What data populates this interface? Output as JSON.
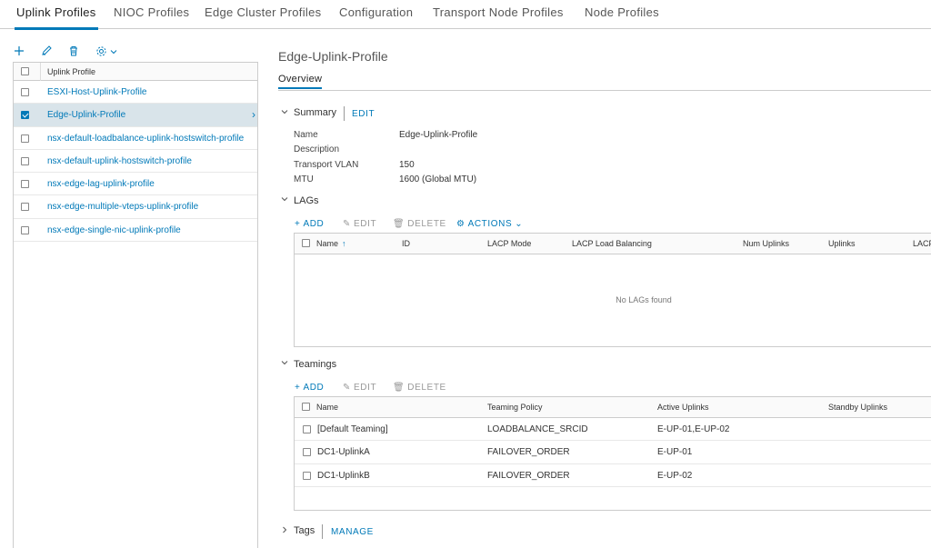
{
  "top_tabs": [
    {
      "label": "Uplink Profiles",
      "active": true
    },
    {
      "label": "NIOC Profiles"
    },
    {
      "label": "Edge Cluster Profiles"
    },
    {
      "label": "Configuration"
    },
    {
      "label": "Transport Node Profiles"
    },
    {
      "label": "Node Profiles"
    }
  ],
  "left_toolbar": {
    "icons": [
      "add-icon",
      "edit-icon",
      "delete-icon",
      "gear-icon",
      "chevron-down-icon"
    ]
  },
  "left_grid": {
    "header": "Uplink Profile",
    "rows": [
      {
        "label": "ESXI-Host-Uplink-Profile",
        "checked": false
      },
      {
        "label": "Edge-Uplink-Profile",
        "checked": true,
        "selected": true
      },
      {
        "label": "nsx-default-loadbalance-uplink-hostswitch-profile",
        "checked": false
      },
      {
        "label": "nsx-default-uplink-hostswitch-profile",
        "checked": false
      },
      {
        "label": "nsx-edge-lag-uplink-profile",
        "checked": false
      },
      {
        "label": "nsx-edge-multiple-vteps-uplink-profile",
        "checked": false
      },
      {
        "label": "nsx-edge-single-nic-uplink-profile",
        "checked": false
      }
    ]
  },
  "detail": {
    "title": "Edge-Uplink-Profile",
    "subtab": "Overview",
    "summary": {
      "label": "Summary",
      "edit": "EDIT",
      "fields": [
        {
          "key": "Name",
          "value": "Edge-Uplink-Profile"
        },
        {
          "key": "Description",
          "value": ""
        },
        {
          "key": "Transport VLAN",
          "value": "150"
        },
        {
          "key": "MTU",
          "value": "1600 (Global MTU)"
        }
      ]
    },
    "lags": {
      "label": "LAGs",
      "actions": {
        "add": "ADD",
        "edit": "EDIT",
        "delete": "DELETE",
        "actions": "ACTIONS"
      },
      "columns": [
        "Name",
        "ID",
        "LACP Mode",
        "LACP Load Balancing",
        "Num Uplinks",
        "Uplinks",
        "LACP"
      ],
      "empty_message": "No LAGs found"
    },
    "teamings": {
      "label": "Teamings",
      "actions": {
        "add": "ADD",
        "edit": "EDIT",
        "delete": "DELETE"
      },
      "columns": [
        "Name",
        "Teaming Policy",
        "Active Uplinks",
        "Standby Uplinks"
      ],
      "rows": [
        [
          "[Default Teaming]",
          "LOADBALANCE_SRCID",
          "E-UP-01,E-UP-02",
          ""
        ],
        [
          "DC1-UplinkA",
          "FAILOVER_ORDER",
          "E-UP-01",
          ""
        ],
        [
          "DC1-UplinkB",
          "FAILOVER_ORDER",
          "E-UP-02",
          ""
        ]
      ]
    },
    "tags": {
      "label": "Tags",
      "manage": "MANAGE"
    }
  },
  "colors": {
    "accent": "#0079b8",
    "selected_row": "#d9e4ea",
    "border": "#cccccc"
  }
}
